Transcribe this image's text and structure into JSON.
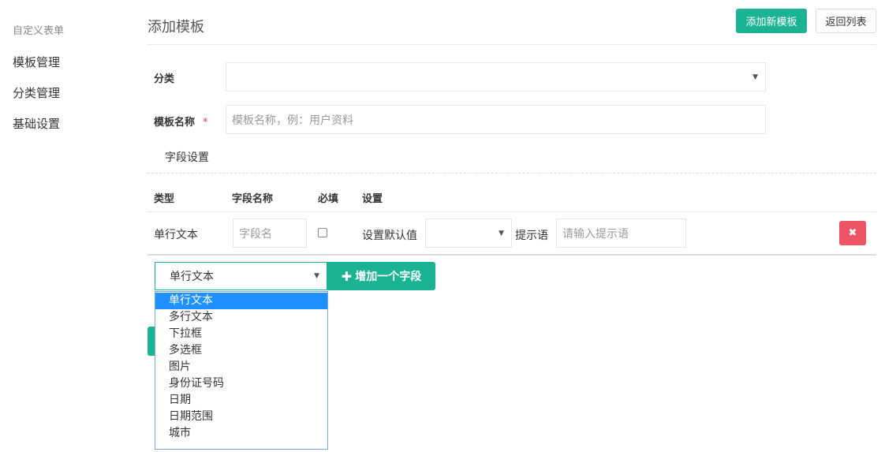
{
  "sidebar": {
    "heading": "自定义表单",
    "items": [
      {
        "label": "模板管理"
      },
      {
        "label": "分类管理"
      },
      {
        "label": "基础设置"
      }
    ]
  },
  "header": {
    "title": "添加模板",
    "primary_button": "添加新模板",
    "back_button": "返回列表"
  },
  "form": {
    "category_label": "分类",
    "category_value": "",
    "name_label": "模板名称",
    "required_mark": "*",
    "name_placeholder": "模板名称，例：用户资料",
    "fields_section_label": "字段设置"
  },
  "field_table": {
    "headers": [
      "类型",
      "字段名称",
      "必填",
      "设置"
    ],
    "rows": [
      {
        "type": "单行文本",
        "name_placeholder": "字段名",
        "required_checked": false,
        "default_label": "设置默认值",
        "default_value": "",
        "hint_label": "提示语",
        "hint_placeholder": "请输入提示语",
        "delete_icon": "close-icon"
      }
    ]
  },
  "add_field": {
    "select_value": "单行文本",
    "button_label": "增加一个字段",
    "button_icon": "plus-icon",
    "options": [
      "单行文本",
      "多行文本",
      "下拉框",
      "多选框",
      "图片",
      "身份证号码",
      "日期",
      "日期范围",
      "城市"
    ],
    "selected_index": 0
  },
  "colors": {
    "accent": "#1ab394",
    "danger": "#ed5565",
    "highlight": "#1e90ff"
  }
}
